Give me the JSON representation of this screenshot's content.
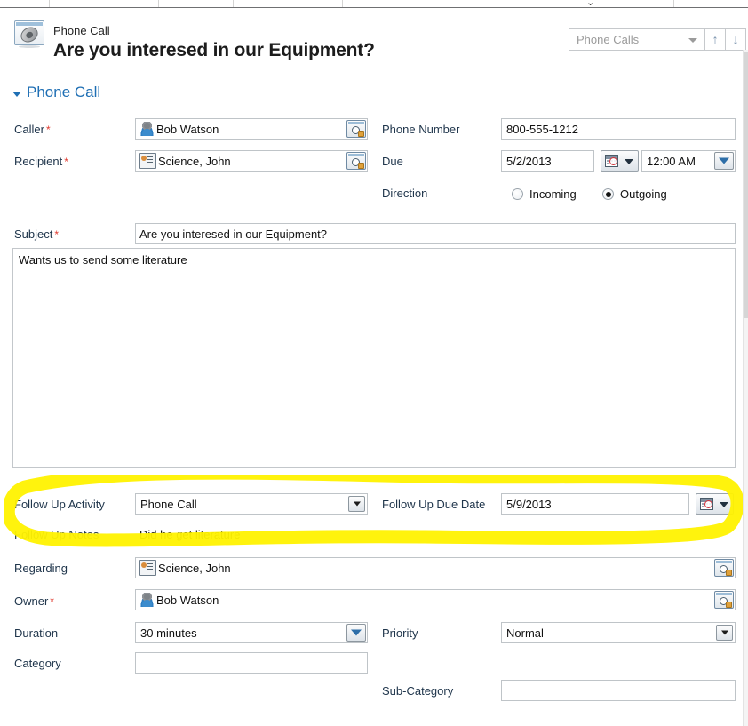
{
  "header": {
    "entity_type": "Phone Call",
    "record_title": "Are you interesed in our Equipment?",
    "entity_icon": "phone-call-icon"
  },
  "recordset": {
    "selected": "Phone Calls",
    "caret_icon": "chevron-down-icon",
    "prev_icon": "arrow-up-icon",
    "next_icon": "arrow-down-icon"
  },
  "section": {
    "heading": "Phone Call",
    "collapse_icon": "triangle-collapse-icon"
  },
  "fields": {
    "caller": {
      "label": "Caller",
      "required": true,
      "value": "Bob Watson",
      "row_icon": "person-icon",
      "lookup_icon": "lookup-search-icon"
    },
    "recipient": {
      "label": "Recipient",
      "required": true,
      "value": "Science, John",
      "row_icon": "contact-card-icon",
      "lookup_icon": "lookup-search-icon"
    },
    "phone_number": {
      "label": "Phone Number",
      "value": "800-555-1212"
    },
    "due": {
      "label": "Due",
      "date_value": "5/2/2013",
      "time_value": "12:00 AM",
      "date_picker_icon": "calendar-clock-icon",
      "time_caret_icon": "chevron-down-icon"
    },
    "direction": {
      "label": "Direction",
      "options": [
        {
          "label": "Incoming",
          "selected": false
        },
        {
          "label": "Outgoing",
          "selected": true
        }
      ]
    },
    "subject": {
      "label": "Subject",
      "required": true,
      "value": "Are you interesed in our Equipment?",
      "focused": true
    },
    "description": {
      "value": "Wants us to send some literature"
    },
    "follow_up_activity": {
      "label": "Follow Up Activity",
      "value": "Phone Call",
      "caret_icon": "chevron-down-icon"
    },
    "follow_up_due_date": {
      "label": "Follow Up Due Date",
      "value": "5/9/2013",
      "date_picker_icon": "calendar-clock-icon"
    },
    "follow_up_notes": {
      "label": "Follow Up Notes",
      "value": "Did he get literature"
    },
    "regarding": {
      "label": "Regarding",
      "value": "Science, John",
      "row_icon": "contact-card-icon",
      "lookup_icon": "lookup-search-icon"
    },
    "owner": {
      "label": "Owner",
      "required": true,
      "value": "Bob Watson",
      "row_icon": "person-icon",
      "lookup_icon": "lookup-search-icon"
    },
    "duration": {
      "label": "Duration",
      "value": "30 minutes",
      "caret_icon": "chevron-down-icon"
    },
    "priority": {
      "label": "Priority",
      "value": "Normal",
      "caret_icon": "chevron-down-icon"
    },
    "category": {
      "label": "Category",
      "value": ""
    },
    "sub_category": {
      "label": "Sub-Category",
      "value": ""
    }
  },
  "annotation": {
    "type": "highlighter-oval",
    "color": "#FFF200",
    "targets": "Follow Up Activity / Follow Up Due Date / Follow Up Notes"
  }
}
